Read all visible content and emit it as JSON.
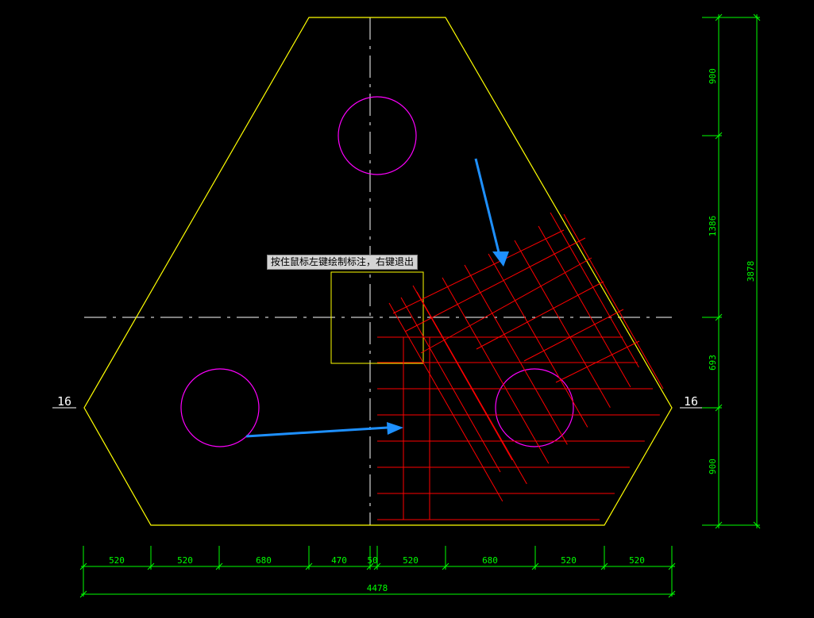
{
  "tooltip": {
    "text": "按住鼠标左键绘制标注，右键退出"
  },
  "section_marks": {
    "left": "16",
    "right": "16"
  },
  "dimensions": {
    "bottom_segments": [
      "520",
      "520",
      "680",
      "470",
      "50",
      "520",
      "680",
      "520",
      "520"
    ],
    "bottom_total": "4478",
    "right_segments": [
      "900",
      "1386",
      "693",
      "900"
    ],
    "right_total": "3878"
  },
  "colors": {
    "outline": "#ffff00",
    "holes": "#ff00ff",
    "rebar": "#ff0000",
    "dimension": "#00ff00",
    "centerline": "#ffffff",
    "annotation_arrow": "#1e90ff"
  }
}
